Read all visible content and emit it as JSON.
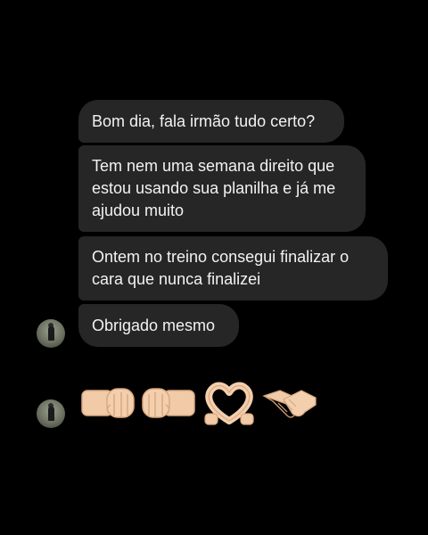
{
  "messages": [
    {
      "text": "Bom dia, fala irmão tudo certo?"
    },
    {
      "text": "Tem nem uma semana direito que\nestou usando sua planilha e já me\najudou muito"
    },
    {
      "text": "Ontem no treino consegui finalizar o\ncara que nunca finalizei"
    },
    {
      "text": "Obrigado mesmo"
    }
  ],
  "emoji_message": {
    "emojis": [
      "left-facing-fist-icon",
      "right-facing-fist-icon",
      "heart-hands-icon",
      "handshake-icon"
    ]
  },
  "colors": {
    "background": "#000000",
    "bubble": "#262626",
    "text": "#f2f2f2",
    "skin": "#f3cfae"
  }
}
